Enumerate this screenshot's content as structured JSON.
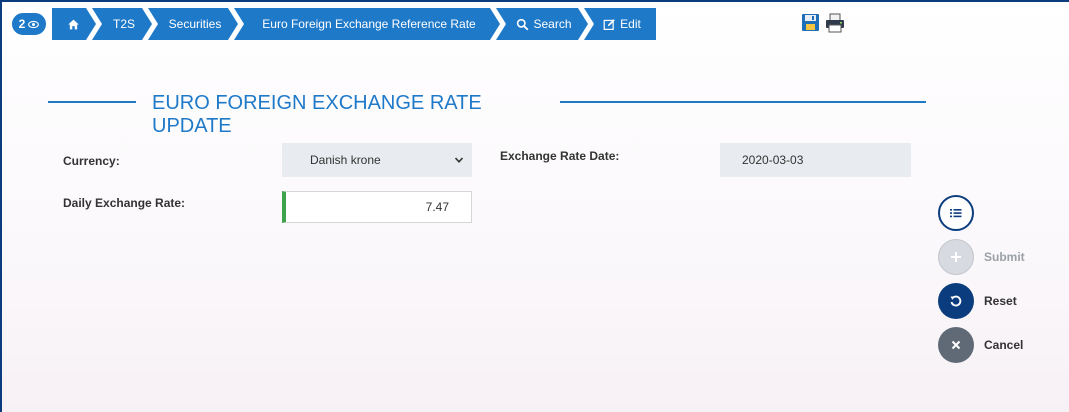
{
  "breadcrumb": {
    "badge_count": "2",
    "items": [
      "T2S",
      "Securities",
      "Euro Foreign Exchange Reference Rate",
      "Search",
      "Edit"
    ]
  },
  "page": {
    "title": "EURO FOREIGN EXCHANGE RATE UPDATE"
  },
  "form": {
    "currency_label": "Currency:",
    "currency_value": "Danish krone",
    "exchange_date_label": "Exchange Rate Date:",
    "exchange_date_value": "2020-03-03",
    "daily_rate_label": "Daily Exchange Rate:",
    "daily_rate_value": "7.47"
  },
  "actions": {
    "submit": "Submit",
    "reset": "Reset",
    "cancel": "Cancel"
  },
  "colors": {
    "primary": "#1f79c9",
    "dark_blue": "#0b3d7e",
    "valid_green": "#3fa34d",
    "cancel_gray": "#5f6a76",
    "disabled_gray": "#d7dae0"
  },
  "icons": [
    "eye-icon",
    "home-icon",
    "search-icon",
    "edit-icon",
    "save-icon",
    "print-icon",
    "list-icon",
    "plus-icon",
    "reset-icon",
    "close-icon",
    "chevron-down-icon"
  ]
}
